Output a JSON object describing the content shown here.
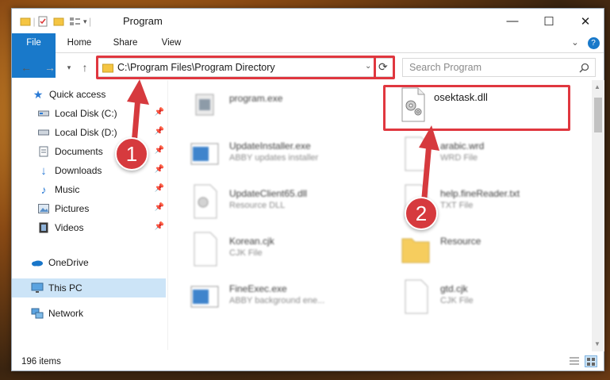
{
  "window": {
    "title": "Program",
    "minimize": "—",
    "maximize": "☐",
    "close": "✕"
  },
  "ribbon": {
    "tabs": [
      {
        "label": "File"
      },
      {
        "label": "Home"
      },
      {
        "label": "Share"
      },
      {
        "label": "View"
      }
    ],
    "help": "?"
  },
  "nav": {
    "address": "C:\\Program Files\\Program Directory",
    "search_placeholder": "Search Program"
  },
  "sidebar": {
    "items": [
      {
        "label": "Quick access",
        "icon": "star-icon"
      },
      {
        "label": "Local Disk (C:)",
        "icon": "drive-icon",
        "pinned": true
      },
      {
        "label": "Local Disk (D:)",
        "icon": "drive-icon",
        "pinned": true
      },
      {
        "label": "Documents",
        "icon": "documents-icon",
        "pinned": true
      },
      {
        "label": "Downloads",
        "icon": "download-icon",
        "pinned": true
      },
      {
        "label": "Music",
        "icon": "music-icon",
        "pinned": true
      },
      {
        "label": "Pictures",
        "icon": "pictures-icon",
        "pinned": true
      },
      {
        "label": "Videos",
        "icon": "videos-icon",
        "pinned": true
      },
      {
        "label": "OneDrive",
        "icon": "cloud-icon"
      },
      {
        "label": "This PC",
        "icon": "computer-icon",
        "selected": true
      },
      {
        "label": "Network",
        "icon": "network-icon"
      }
    ]
  },
  "files": [
    {
      "name": "program.exe",
      "sub": ""
    },
    {
      "name": "osektask.dll",
      "sub": ""
    },
    {
      "name": "UpdateInstaller.exe",
      "sub": "ABBY updates installer"
    },
    {
      "name": "arabic.wrd",
      "sub": "WRD File"
    },
    {
      "name": "UpdateClient65.dll",
      "sub": "Resource DLL"
    },
    {
      "name": "help.fineReader.txt",
      "sub": "TXT File"
    },
    {
      "name": "Korean.cjk",
      "sub": "CJK File"
    },
    {
      "name": "Resource",
      "sub": ""
    },
    {
      "name": "FineExec.exe",
      "sub": "ABBY background ene..."
    },
    {
      "name": "gtd.cjk",
      "sub": "CJK File"
    }
  ],
  "status": {
    "count": "196 items"
  },
  "callouts": {
    "one": "1",
    "two": "2"
  },
  "colors": {
    "accent": "#1979ca",
    "highlight": "#e0373f",
    "selection": "#cce4f7"
  }
}
